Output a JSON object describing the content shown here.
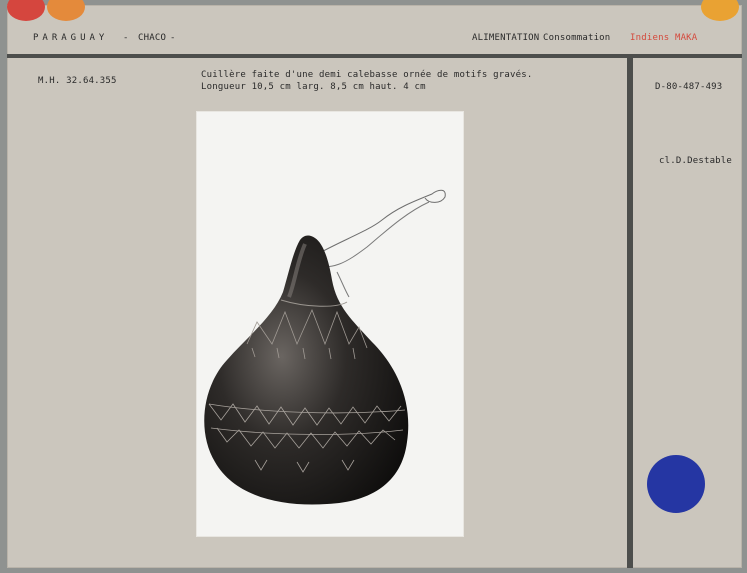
{
  "header": {
    "country": "PARAGUAY",
    "separator": "-",
    "region": "CHACO",
    "trailing_dash": "-",
    "category": "ALIMENTATION",
    "subcategory": "Consommation",
    "people": "Indiens MAKA"
  },
  "record": {
    "inventory_number": "M.H. 32.64.355",
    "description": "Cuillère faite d'une demi calebasse ornée de motifs gravés.",
    "dimensions": "Longueur 10,5 cm   larg. 8,5 cm  haut. 4 cm",
    "photo_number": "D-80-487-493",
    "photo_credit": "cl.D.Destable"
  },
  "colors": {
    "tab_red": "#d5463e",
    "tab_orange": "#e48a3b",
    "tab_yellow": "#e9a233",
    "dot_blue": "#2536a3",
    "people_red": "#d44a3d"
  }
}
